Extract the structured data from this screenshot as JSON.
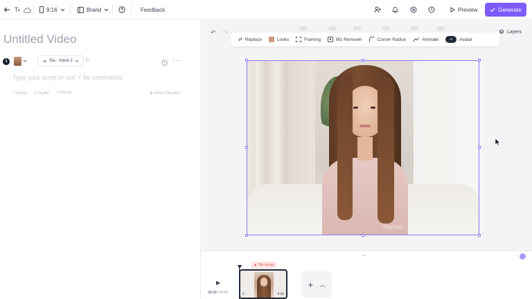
{
  "topbar": {
    "aspect_ratio": "9:16",
    "brand_label": "Brand",
    "feedback_label": "Feedback",
    "preview_label": "Preview",
    "generate_label": "Generate",
    "accent_color": "#7c5cfc"
  },
  "script_panel": {
    "video_title": "Untitled Video",
    "scene_number": "1",
    "voice_label": "Sia - Voice 2",
    "script_placeholder": "Type your script or use '/' for commands",
    "tools": [
      "Scene",
      "Audio",
      "Pause"
    ],
    "voice_director_label": "Voice Director"
  },
  "canvas": {
    "layers_label": "Layers",
    "toolbar": [
      {
        "label": "Replace",
        "icon": "replace-icon"
      },
      {
        "label": "Looks",
        "icon": "looks-icon"
      },
      {
        "label": "Framing",
        "icon": "framing-icon"
      },
      {
        "label": "BG Remover",
        "icon": "bg-remover-icon"
      },
      {
        "label": "Corner Radius",
        "icon": "corner-radius-icon"
      },
      {
        "label": "Animate",
        "icon": "animate-icon"
      },
      {
        "label": "Avatar",
        "icon": "avatar-icon"
      }
    ],
    "watermark": "HeyGen",
    "selection_color": "#8b7cf6"
  },
  "timeline": {
    "no_script_label": "No script",
    "current_time": "00:00",
    "total_time": "00:00",
    "clip_duration": "0.0s",
    "clip_number": "1"
  }
}
